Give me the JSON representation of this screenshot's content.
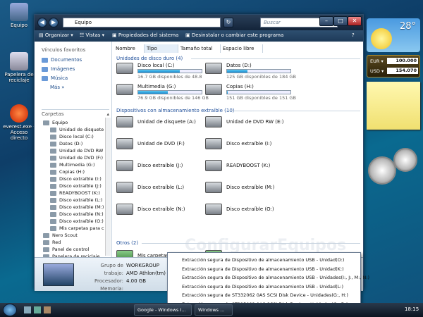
{
  "desktop": {
    "icons": [
      {
        "label": "Equipo",
        "icon": "computer-icon"
      },
      {
        "label": "Papelera de reciclaje",
        "icon": "recycle-bin-icon"
      },
      {
        "label": "everest.exe - Acceso directo",
        "icon": "everest-icon"
      }
    ]
  },
  "window": {
    "address": "Equipo",
    "search_placeholder": "Buscar",
    "toolbar": {
      "organize": "Organizar",
      "views": "Vistas",
      "properties": "Propiedades del sistema",
      "uninstall": "Desinstalar o cambiar este programa"
    },
    "nav": {
      "favorites_header": "Vínculos favoritos",
      "favorites": [
        "Documentos",
        "Imágenes",
        "Música"
      ],
      "more": "Más",
      "folders_header": "Carpetas",
      "tree": [
        "Equipo",
        "Unidad de disquete",
        "Disco local (C:)",
        "Datos (D:)",
        "Unidad de DVD RW",
        "Unidad de DVD (F:)",
        "Multimedia (G:)",
        "Copias (H:)",
        "Disco extraíble (I:)",
        "Disco extraíble (J:)",
        "READYBOOST (K:)",
        "Disco extraíble (L:)",
        "Disco extraíble (M:)",
        "Disco extraíble (N:)",
        "Disco extraíble (O:)",
        "Mis carpetas para c",
        "Nero Scout",
        "Red",
        "Panel de control",
        "Papelera de reciclaje"
      ]
    },
    "columns": [
      "Nombre",
      "Tipo",
      "Tamaño total",
      "Espacio libre"
    ],
    "groups": {
      "hdd": "Unidades de disco duro (4)",
      "removable": "Dispositivos con almacenamiento extraíble (10)",
      "other": "Otros (2)"
    },
    "hdd": [
      {
        "name": "Disco local (C:)",
        "size": "16.7 GB disponibles de 48.8",
        "fill": 0.66
      },
      {
        "name": "Datos (D:)",
        "size": "125 GB disponibles de 184 GB",
        "fill": 0.32
      },
      {
        "name": "Multimedia (G:)",
        "size": "76.9 GB disponibles de 146 GB",
        "fill": 0.47
      },
      {
        "name": "Copias (H:)",
        "size": "151 GB disponibles de 151 GB",
        "fill": 0.01
      }
    ],
    "removable": [
      "Unidad de disquete (A:)",
      "Unidad de DVD RW (E:)",
      "Unidad de DVD (F:)",
      "Disco extraíble (I:)",
      "Disco extraíble (J:)",
      "READYBOOST (K:)",
      "Disco extraíble (L:)",
      "Disco extraíble (M:)",
      "Disco extraíble (N:)",
      "Disco extraíble (O:)"
    ],
    "other": [
      "Mis carpetas para compartir",
      "Nero Scout"
    ],
    "details": {
      "workgroup_label": "Grupo de trabajo:",
      "workgroup": "WORKGROUP",
      "cpu_label": "Procesador:",
      "cpu": "AMD Athlon(tm) 6",
      "memory_label": "Memoria:",
      "memory": "4.00 GB"
    }
  },
  "sidebar": {
    "weather_temp": "28°",
    "currency": [
      {
        "code": "EUR",
        "value": "100.000"
      },
      {
        "code": "USD",
        "value": "154.070"
      }
    ]
  },
  "popup": {
    "items": [
      "Extracción segura de Dispositivo de almacenamiento USB - Unidad(O:)",
      "Extracción segura de Dispositivo de almacenamiento USB - Unidad(K:)",
      "Extracción segura de Dispositivo de almacenamiento USB - Unidades(I:, J:, M:, N:)",
      "Extracción segura de Dispositivo de almacenamiento USB - Unidad(L:)",
      "Extracción segura de ST332062 0AS SCSI Disk Device - Unidades(G:, H:)",
      "Extracción segura de ST325082 0AS SCSI Disk Device - Unidades(C:, D:)"
    ]
  },
  "watermark": "ConfigurarEquipos",
  "taskbar": {
    "tasks": [
      "Google - Windows I...",
      "Windows ..."
    ],
    "clock": "18:15"
  }
}
